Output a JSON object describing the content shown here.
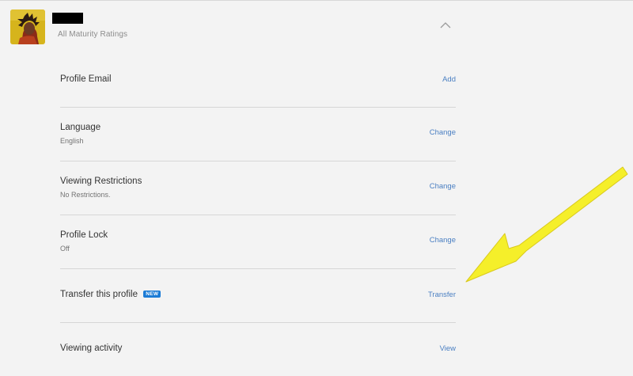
{
  "profile": {
    "subtitle": "All Maturity Ratings"
  },
  "settings": {
    "rows": [
      {
        "title": "Profile Email",
        "value": "",
        "action": "Add"
      },
      {
        "title": "Language",
        "value": "English",
        "action": "Change"
      },
      {
        "title": "Viewing Restrictions",
        "value": "No Restrictions.",
        "action": "Change"
      },
      {
        "title": "Profile Lock",
        "value": "Off",
        "action": "Change"
      },
      {
        "title": "Transfer this profile",
        "badge": "NEW",
        "value": "",
        "action": "Transfer"
      },
      {
        "title": "Viewing activity",
        "value": "",
        "action": "View"
      }
    ]
  },
  "colors": {
    "link": "#4a7fc2",
    "badge": "#1c7cd6",
    "annotation_arrow": "#f5ef2a"
  },
  "icons": {
    "collapse": "chevron-up-icon"
  }
}
